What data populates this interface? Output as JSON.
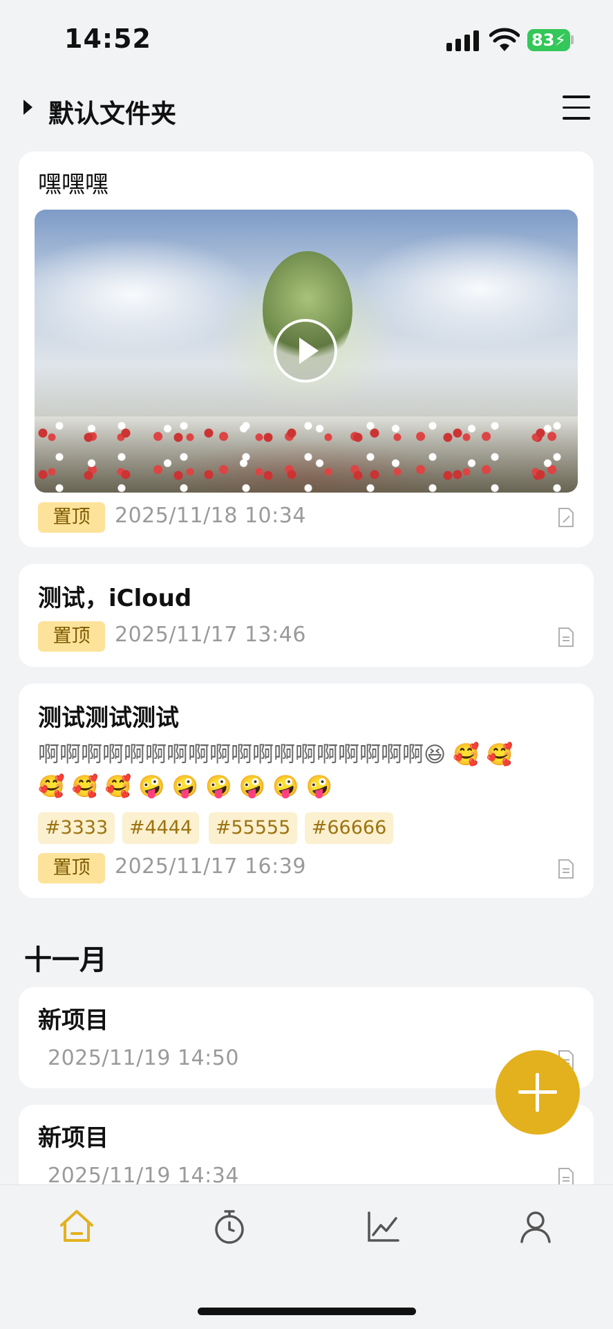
{
  "status_bar": {
    "time": "14:52",
    "battery": "83"
  },
  "header": {
    "folder_title": "默认文件夹"
  },
  "cards": [
    {
      "title": "嘿嘿嘿",
      "pin_label": "置顶",
      "date": "2025/11/18  10:34",
      "has_video": true
    },
    {
      "title": "测试，iCloud",
      "pin_label": "置顶",
      "date": "2025/11/17  13:46"
    },
    {
      "title": "测试测试测试",
      "body_line1": "啊啊啊啊啊啊啊啊啊啊啊啊啊啊啊啊啊啊😆 🥰 🥰",
      "body_line2": "🥰 🥰 🥰 🤪 🤪 🤪 🤪 🤪 🤪",
      "tags": [
        "#3333",
        "#4444",
        "#55555",
        "#66666"
      ],
      "pin_label": "置顶",
      "date": "2025/11/17  16:39"
    }
  ],
  "section_title": "十一月",
  "month_items": [
    {
      "title": "新项目",
      "date": "2025/11/19  14:50"
    },
    {
      "title": "新项目",
      "date": "2025/11/19  14:34"
    }
  ],
  "tabbar": {
    "items": [
      "home-icon",
      "timer-icon",
      "chart-icon",
      "profile-icon"
    ],
    "active_color": "#e3b11d"
  },
  "colors": {
    "accent": "#e3b11d",
    "pin_bg": "#fde29a",
    "tag_bg": "#fbf0cf",
    "background": "#f2f3f5"
  }
}
